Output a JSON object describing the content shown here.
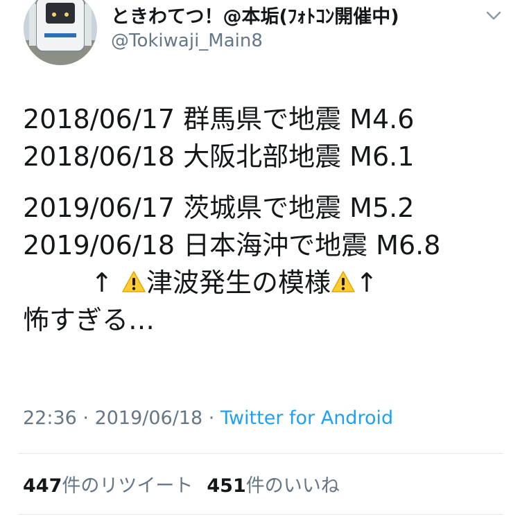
{
  "user": {
    "display_name": "ときわてつ！@本垢(ﾌｫﾄｺﾝ開催中)",
    "handle": "@Tokiwaji_Main8",
    "avatar_icon": "train-avatar-icon"
  },
  "menu_icon": "chevron-down-icon",
  "tweet": {
    "lines": [
      "2018/06/17 群馬県で地震 M4.6",
      "2018/06/18 大阪北部地震 M6.1",
      "2019/06/17 茨城県で地震 M5.2",
      "2019/06/18 日本海沖で地震 M6.8"
    ],
    "tsunami": {
      "arrow_left": "↑",
      "text": "津波発生の模様",
      "arrow_right": "↑",
      "warning_icon": "warning-icon"
    },
    "closing": "怖すぎる…"
  },
  "meta": {
    "time": "22:36",
    "sep1": " · ",
    "date": "2019/06/18",
    "sep2": " · ",
    "source": "Twitter for Android"
  },
  "stats": {
    "retweets_count": "447",
    "retweets_label": "件のリツイート",
    "likes_count": "451",
    "likes_label": "件のいいね"
  },
  "colors": {
    "text": "#14171a",
    "secondary": "#657786",
    "link": "#1da1f2",
    "divider": "#e1e8ed",
    "warning": "#ffcc33"
  }
}
